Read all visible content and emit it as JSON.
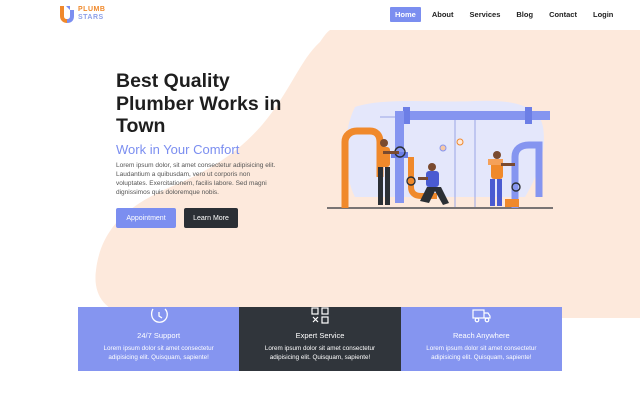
{
  "brand": {
    "name_line1": "PLUMB",
    "name_line2": "STARS",
    "colors": {
      "primary": "#7b8ef0",
      "orange": "#f0892b",
      "dark": "#30353b",
      "peach": "#fde9dc"
    }
  },
  "nav": {
    "items": [
      {
        "label": "Home",
        "active": true
      },
      {
        "label": "About",
        "active": false
      },
      {
        "label": "Services",
        "active": false
      },
      {
        "label": "Blog",
        "active": false
      },
      {
        "label": "Contact",
        "active": false
      },
      {
        "label": "Login",
        "active": false
      }
    ]
  },
  "hero": {
    "title": "Best Quality Plumber Works in Town",
    "subtitle": "Work in Your Comfort",
    "description": "Lorem ipsum dolor, sit amet consectetur adipisicing elit. Laudantium a quibusdam, vero ut corporis non voluptates. Exercitationem, facilis labore. Sed magni dignissimos quis doloremque nobis.",
    "primary_button": "Appointment",
    "secondary_button": "Learn More",
    "illustration_icon": "plumbers-pipes-illustration"
  },
  "features": [
    {
      "icon": "clock-icon",
      "title": "24/7 Support",
      "desc": "Lorem ipsum dolor sit amet consectetur adipisicing elit. Quisquam, sapiente!"
    },
    {
      "icon": "tools-icon",
      "title": "Expert Service",
      "desc": "Lorem ipsum dolor sit amet consectetur adipisicing elit. Quisquam, sapiente!"
    },
    {
      "icon": "truck-icon",
      "title": "Reach Anywhere",
      "desc": "Lorem ipsum dolor sit amet consectetur adipisicing elit. Quisquam, sapiente!"
    }
  ]
}
